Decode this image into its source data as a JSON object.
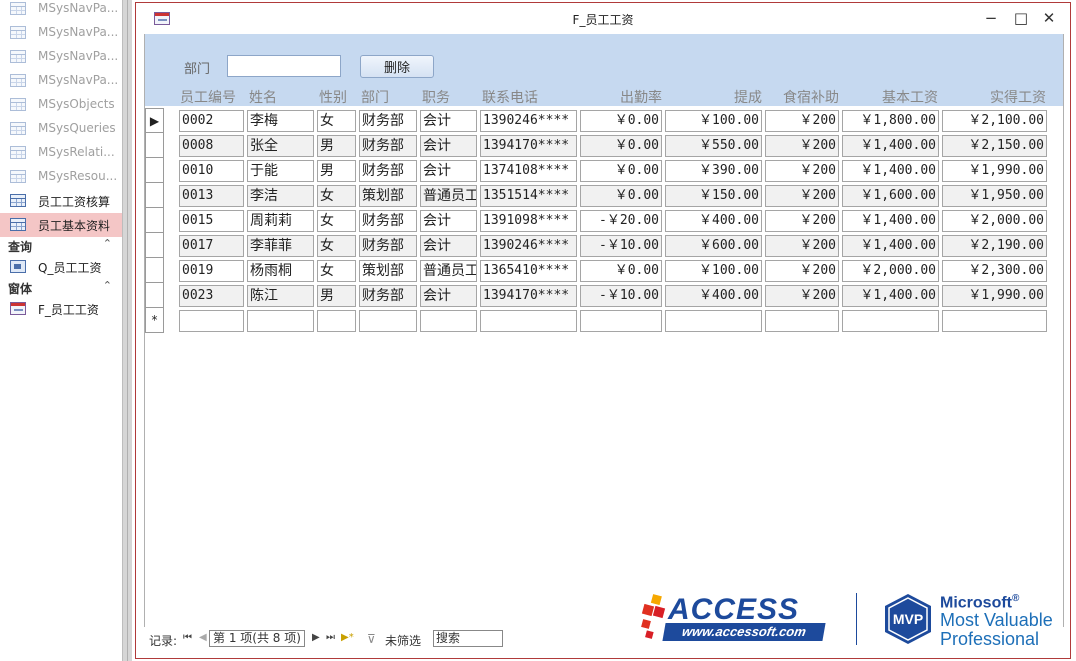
{
  "nav": {
    "tables": [
      {
        "label": "MSysNavPa...",
        "system": true
      },
      {
        "label": "MSysNavPa...",
        "system": true
      },
      {
        "label": "MSysNavPa...",
        "system": true
      },
      {
        "label": "MSysNavPa...",
        "system": true
      },
      {
        "label": "MSysObjects",
        "system": true
      },
      {
        "label": "MSysQueries",
        "system": true
      },
      {
        "label": "MSysRelati...",
        "system": true
      },
      {
        "label": "MSysResou...",
        "system": true
      },
      {
        "label": "员工工资核算",
        "system": false
      },
      {
        "label": "员工基本资料",
        "system": false,
        "selected": true
      }
    ],
    "group_queries": "查询",
    "queries": [
      {
        "label": "Q_员工工资"
      }
    ],
    "group_forms": "窗体",
    "forms": [
      {
        "label": "F_员工工资"
      }
    ],
    "collapse_glyph": "⌃"
  },
  "window": {
    "title": "F_员工工资",
    "minimize": "−",
    "maximize": "□",
    "close": "✕"
  },
  "form": {
    "dept_label": "部门",
    "dept_value": "",
    "delete_label": "删除",
    "columns": [
      "员工编号",
      "姓名",
      "性别",
      "部门",
      "职务",
      "联系电话",
      "出勤率",
      "提成",
      "食宿补助",
      "基本工资",
      "实得工资"
    ],
    "rows": [
      [
        "0002",
        "李梅",
        "女",
        "财务部",
        "会计",
        "1390246****",
        "￥0.00",
        "￥100.00",
        "￥200",
        "￥1,800.00",
        "￥2,100.00"
      ],
      [
        "0008",
        "张全",
        "男",
        "财务部",
        "会计",
        "1394170****",
        "￥0.00",
        "￥550.00",
        "￥200",
        "￥1,400.00",
        "￥2,150.00"
      ],
      [
        "0010",
        "于能",
        "男",
        "财务部",
        "会计",
        "1374108****",
        "￥0.00",
        "￥390.00",
        "￥200",
        "￥1,400.00",
        "￥1,990.00"
      ],
      [
        "0013",
        "李洁",
        "女",
        "策划部",
        "普通员工",
        "1351514****",
        "￥0.00",
        "￥150.00",
        "￥200",
        "￥1,600.00",
        "￥1,950.00"
      ],
      [
        "0015",
        "周莉莉",
        "女",
        "财务部",
        "会计",
        "1391098****",
        "-￥20.00",
        "￥400.00",
        "￥200",
        "￥1,400.00",
        "￥2,000.00"
      ],
      [
        "0017",
        "李菲菲",
        "女",
        "财务部",
        "会计",
        "1390246****",
        "-￥10.00",
        "￥600.00",
        "￥200",
        "￥1,400.00",
        "￥2,190.00"
      ],
      [
        "0019",
        "杨雨桐",
        "女",
        "策划部",
        "普通员工",
        "1365410****",
        "￥0.00",
        "￥100.00",
        "￥200",
        "￥2,000.00",
        "￥2,300.00"
      ],
      [
        "0023",
        "陈江",
        "男",
        "财务部",
        "会计",
        "1394170****",
        "-￥10.00",
        "￥400.00",
        "￥200",
        "￥1,400.00",
        "￥1,990.00"
      ]
    ],
    "current_marker": "▶",
    "new_marker": "*"
  },
  "recnav": {
    "label": "记录:",
    "first": "⏮",
    "prev": "◀",
    "position": "第 1 项(共 8 项)",
    "next": "▶",
    "last": "⏭",
    "new": "▶*",
    "filter": "未筛选",
    "search": "搜索"
  },
  "logos": {
    "access": "ACCESS",
    "access_url": "www.accessoft.com",
    "mvp_badge": "MVP",
    "mvp_line1": "Microsoft",
    "mvp_reg": "®",
    "mvp_line2": "Most Valuable",
    "mvp_line3": "Professional"
  },
  "colors": {
    "header_band": "#c6d9f0",
    "selected_nav": "#f4c6c6",
    "window_border": "#b03a3a",
    "brand_blue": "#1d4a9c"
  }
}
